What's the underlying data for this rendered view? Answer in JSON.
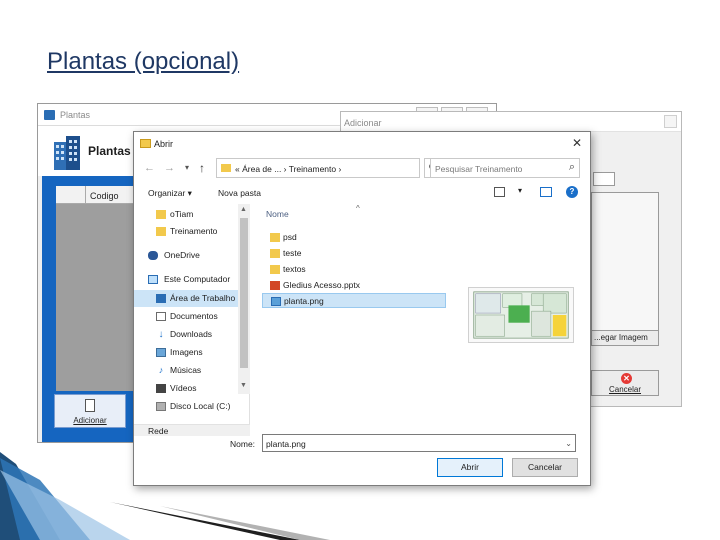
{
  "slide": {
    "title": "Plantas (opcional)"
  },
  "app_window": {
    "title": "Plantas",
    "heading": "Plantas",
    "column_header": "Codigo",
    "add_button": "Adicionar",
    "minimize": "—",
    "maximize": "□",
    "close": "✕"
  },
  "add_window": {
    "title": "Adicionar",
    "load_image_button": "Carregar Imagem",
    "load_image_visible": "...egar Imagem",
    "cancel_button": "Cancelar"
  },
  "dialog": {
    "title": "Abrir",
    "close": "✕",
    "address": "« Área de ... › Treinamento ›",
    "search_placeholder": "Pesquisar Treinamento",
    "organize": "Organizar ▾",
    "new_folder": "Nova pasta",
    "nav_items": [
      {
        "label": "oTiam",
        "icon": "folder-icon"
      },
      {
        "label": "Treinamento",
        "icon": "folder-icon"
      },
      {
        "label": "OneDrive",
        "icon": "onedrive-icon"
      },
      {
        "label": "Este Computador",
        "icon": "computer-icon"
      },
      {
        "label": "Área de Trabalho",
        "icon": "desktop-icon"
      },
      {
        "label": "Documentos",
        "icon": "documents-icon"
      },
      {
        "label": "Downloads",
        "icon": "downloads-icon"
      },
      {
        "label": "Imagens",
        "icon": "images-icon"
      },
      {
        "label": "Músicas",
        "icon": "music-icon"
      },
      {
        "label": "Vídeos",
        "icon": "videos-icon"
      },
      {
        "label": "Disco Local (C:)",
        "icon": "disk-icon"
      }
    ],
    "bottom_nav": "Rede",
    "column_name": "Nome",
    "files": [
      {
        "label": "psd",
        "icon": "folder-icon"
      },
      {
        "label": "teste",
        "icon": "folder-icon"
      },
      {
        "label": "textos",
        "icon": "folder-icon"
      },
      {
        "label": "Gledius Acesso.pptx",
        "icon": "pptx-icon"
      },
      {
        "label": "planta.png",
        "icon": "image-file-icon"
      }
    ],
    "name_label": "Nome:",
    "name_value": "planta.png",
    "open_button": "Abrir",
    "cancel_button": "Cancelar"
  },
  "colors": {
    "accent": "#1565c0",
    "selection": "#cce4f7",
    "title": "#1f3864"
  }
}
